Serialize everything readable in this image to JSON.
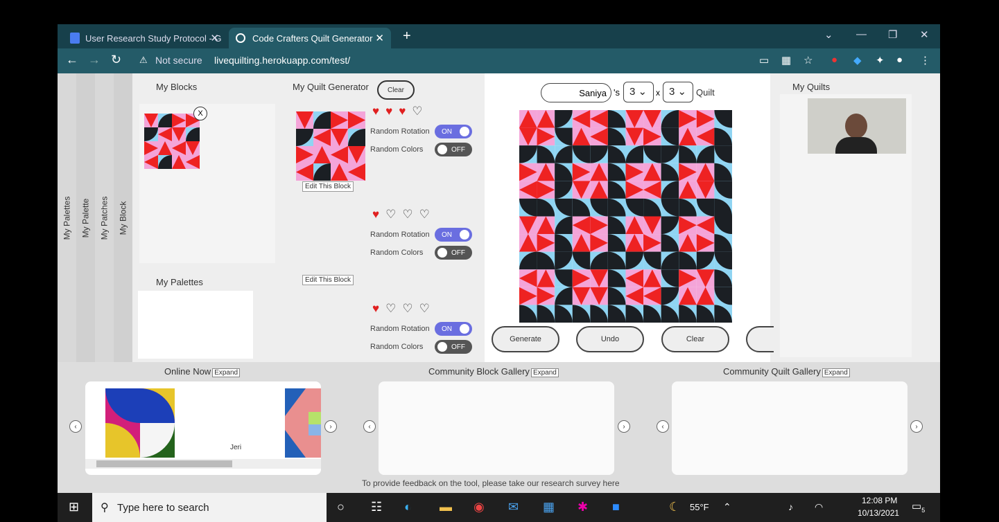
{
  "browser": {
    "tabs": [
      {
        "title": "User Research Study Protocol - G"
      },
      {
        "title": "Code Crafters Quilt Generator"
      }
    ],
    "security_label": "Not secure",
    "url": "livequilting.herokuapp.com/test/"
  },
  "sidebar_tabs": [
    "My Palettes",
    "My Palette",
    "My Patches",
    "My Block"
  ],
  "blocks_panel": {
    "title": "My Blocks",
    "remove_label": "X"
  },
  "palettes_panel": {
    "title": "My Palettes"
  },
  "generator": {
    "title": "My Quilt Generator",
    "clear_label": "Clear",
    "edit_label": "Edit This Block",
    "rotation_label": "Random Rotation",
    "colors_label": "Random Colors",
    "on_label": "ON",
    "off_label": "OFF",
    "rows": [
      {
        "rotation": "ON",
        "colors": "OFF"
      },
      {
        "rotation": "ON",
        "colors": "OFF"
      },
      {
        "rotation": "ON",
        "colors": "OFF"
      }
    ]
  },
  "quilt": {
    "name": "Saniya",
    "possessive": "'s",
    "rows": "3",
    "times": "x",
    "cols": "3",
    "suffix": "Quilt",
    "buttons": {
      "generate": "Generate",
      "undo": "Undo",
      "clear": "Clear"
    }
  },
  "quilts_panel": {
    "title": "My Quilts"
  },
  "gallery": {
    "online": {
      "title": "Online Now",
      "expand": "Expand",
      "user": "Jeri"
    },
    "block": {
      "title": "Community Block Gallery",
      "expand": "Expand"
    },
    "quilt": {
      "title": "Community Quilt Gallery",
      "expand": "Expand"
    },
    "feedback": "To provide feedback on the tool, please take our research survey ",
    "feedback_link": "here"
  },
  "taskbar": {
    "search": "Type here to search",
    "temp": "55°F",
    "time": "12:08 PM",
    "date": "10/13/2021",
    "notifications": "5"
  },
  "colors": {
    "black": "#1b1f24",
    "red": "#ee2222",
    "pink": "#f4a4d8",
    "blue": "#8fd4f2"
  }
}
